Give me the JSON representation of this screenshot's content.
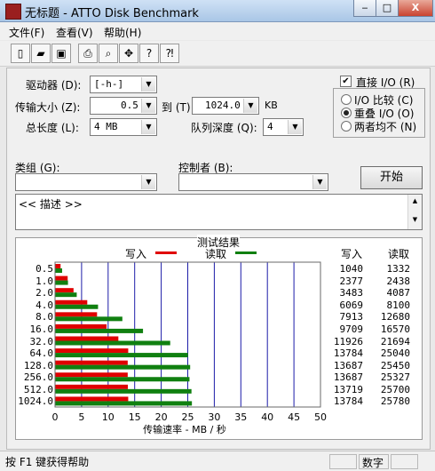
{
  "window": {
    "title": "无标题 - ATTO Disk Benchmark",
    "minimize": "‒",
    "maximize": "□",
    "close": "X"
  },
  "menu": [
    "文件(F)",
    "查看(V)",
    "帮助(H)"
  ],
  "toolbar": [
    {
      "icon": "new-file-icon",
      "glyph": "▯"
    },
    {
      "icon": "open-folder-icon",
      "glyph": "▰"
    },
    {
      "icon": "save-icon",
      "glyph": "▣"
    },
    {
      "icon": "print-icon",
      "glyph": "⎙"
    },
    {
      "icon": "print-preview-icon",
      "glyph": "⌕"
    },
    {
      "icon": "move-icon",
      "glyph": "✥"
    },
    {
      "icon": "help-icon",
      "glyph": "?"
    },
    {
      "icon": "context-help-icon",
      "glyph": "⁈"
    }
  ],
  "form": {
    "drive_label": "驱动器 (D):",
    "drive_value": "[-h-]",
    "transfer_label": "传输大小 (Z):",
    "transfer_from": "0.5",
    "to_label": "到 (T)",
    "transfer_to": "1024.0",
    "kb_unit": "KB",
    "total_label": "总长度 (L):",
    "total_value": "4 MB",
    "queue_label": "队列深度 (Q):",
    "queue_value": "4",
    "direct_io_label": "直接 I/O (R)",
    "direct_io_checked": true,
    "io_compare": "I/O 比较 (C)",
    "overlapped_io": "重叠 I/O (O)",
    "neither": "两者均不 (N)",
    "selected_io": "overlapped",
    "group_label": "类组 (G):",
    "group_value": "",
    "controller_label": "控制者 (B):",
    "controller_value": "",
    "start_button": "开始",
    "description": "<< 描述 >>"
  },
  "results_titles": {
    "title": "测试结果",
    "write_legend": "写入",
    "read_legend": "读取",
    "write_col": "写入",
    "read_col": "读取"
  },
  "colors": {
    "write": "#e00000",
    "read": "#108010",
    "grid": "#1c1ca8"
  },
  "chart_data": {
    "type": "bar",
    "orientation": "horizontal",
    "title": "测试结果",
    "xlabel": "传输速率 - MB / 秒",
    "xlim": [
      0,
      50
    ],
    "xticks": [
      "0",
      "5",
      "10",
      "15",
      "20",
      "25",
      "30",
      "35",
      "40",
      "45",
      "50"
    ],
    "categories": [
      "0.5",
      "1.0",
      "2.0",
      "4.0",
      "8.0",
      "16.0",
      "32.0",
      "64.0",
      "128.0",
      "256.0",
      "512.0",
      "1024.0"
    ],
    "series": [
      {
        "name": "写入",
        "values": [
          1040,
          2377,
          3483,
          6069,
          7913,
          9709,
          11926,
          13784,
          13687,
          13687,
          13719,
          13784
        ]
      },
      {
        "name": "读取",
        "values": [
          1332,
          2438,
          4087,
          8100,
          12680,
          16570,
          21694,
          25040,
          25450,
          25327,
          25700,
          25780
        ]
      }
    ],
    "value_unit_divisor": 1000
  },
  "status": {
    "help_text": "按 F1 键获得帮助",
    "num": "数字"
  }
}
